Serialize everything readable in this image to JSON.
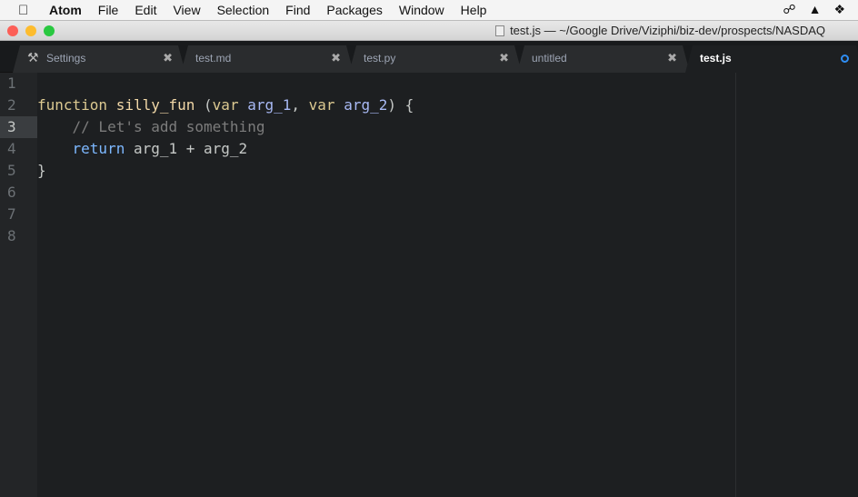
{
  "menubar": {
    "app": "Atom",
    "items": [
      "File",
      "Edit",
      "View",
      "Selection",
      "Find",
      "Packages",
      "Window",
      "Help"
    ]
  },
  "window": {
    "title": "test.js — ~/Google Drive/Viziphi/biz-dev/prospects/NASDAQ"
  },
  "tabs": [
    {
      "label": "Settings",
      "icon": "tools-icon"
    },
    {
      "label": "test.md"
    },
    {
      "label": "test.py"
    },
    {
      "label": "untitled"
    },
    {
      "label": "test.js",
      "active": true,
      "modified": true
    }
  ],
  "editor": {
    "line_numbers": [
      "1",
      "2",
      "3",
      "4",
      "5",
      "6",
      "7",
      "8"
    ],
    "current_line": 3,
    "code": {
      "l2": {
        "kw1": "function",
        "name": "silly_fun",
        "p1": " (",
        "kw2": "var",
        "a1": "arg_1",
        "p2": ", ",
        "kw3": "var",
        "a2": "arg_2",
        "p3": ") {"
      },
      "l3": "    // Let's add something",
      "l4": {
        "kw": "return",
        "rest": " arg_1 + arg_2"
      },
      "l5": "}"
    }
  }
}
